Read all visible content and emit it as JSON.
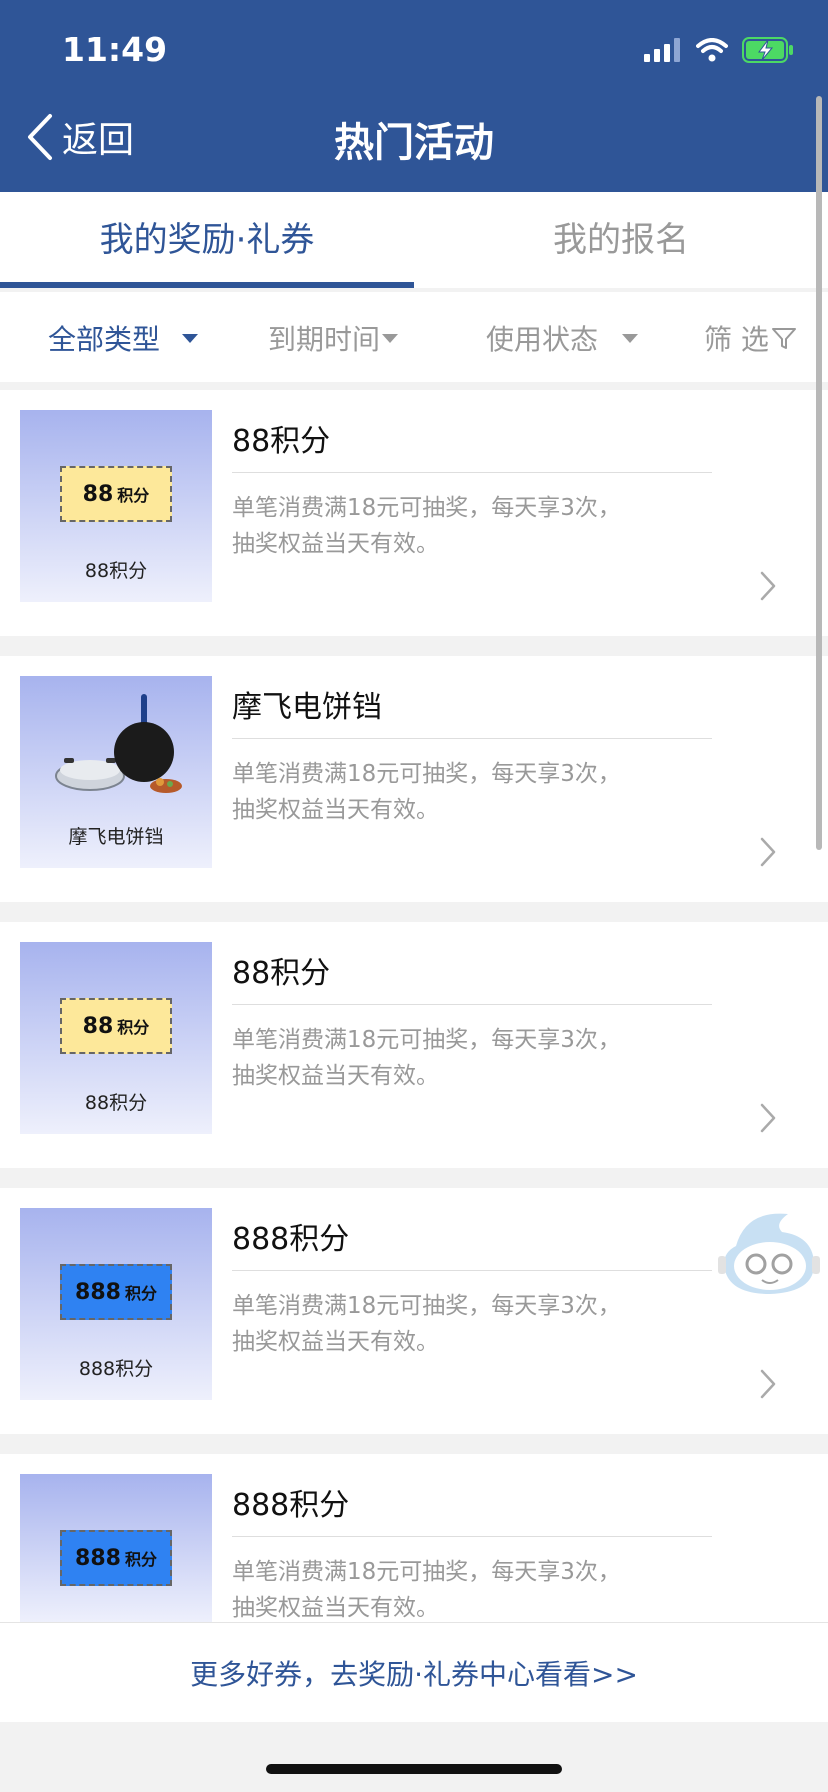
{
  "status_bar": {
    "time": "11:49"
  },
  "header": {
    "back_label": "返回",
    "title": "热门活动"
  },
  "tabs": [
    {
      "label": "我的奖励·礼券",
      "active": true
    },
    {
      "label": "我的报名",
      "active": false
    }
  ],
  "filters": [
    {
      "label": "全部类型",
      "active": true
    },
    {
      "label": "到期时间",
      "active": false
    },
    {
      "label": "使用状态",
      "active": false
    },
    {
      "label": "筛 选",
      "active": false
    }
  ],
  "cards": [
    {
      "title": "88积分",
      "desc_line1": "单笔消费满18元可抽奖，每天享3次，",
      "desc_line2": "抽奖权益当天有效。",
      "thumb_num": "88",
      "thumb_unit": "积分",
      "thumb_caption": "88积分",
      "thumb_style": "yellow"
    },
    {
      "title": "摩飞电饼铛",
      "desc_line1": "单笔消费满18元可抽奖，每天享3次，",
      "desc_line2": "抽奖权益当天有效。",
      "thumb_caption": "摩飞电饼铛",
      "thumb_style": "product"
    },
    {
      "title": "88积分",
      "desc_line1": "单笔消费满18元可抽奖，每天享3次，",
      "desc_line2": "抽奖权益当天有效。",
      "thumb_num": "88",
      "thumb_unit": "积分",
      "thumb_caption": "88积分",
      "thumb_style": "yellow"
    },
    {
      "title": "888积分",
      "desc_line1": "单笔消费满18元可抽奖，每天享3次，",
      "desc_line2": "抽奖权益当天有效。",
      "thumb_num": "888",
      "thumb_unit": "积分",
      "thumb_caption": "888积分",
      "thumb_style": "blue"
    },
    {
      "title": "888积分",
      "desc_line1": "单笔消费满18元可抽奖，每天享3次，",
      "desc_line2": "抽奖权益当天有效。",
      "thumb_num": "888",
      "thumb_unit": "积分",
      "thumb_caption": "",
      "thumb_style": "blue"
    }
  ],
  "footer": {
    "link": "更多好券，去奖励·礼券中心看看>>"
  },
  "colors": {
    "primary": "#2f5597",
    "ticket_yellow": "#fde89a",
    "ticket_blue": "#2f82f2",
    "battery_green": "#4cd964"
  },
  "icons": [
    "chevron-left-icon",
    "signal-icon",
    "wifi-icon",
    "battery-charging-icon",
    "caret-down-icon",
    "filter-funnel-icon",
    "chevron-right-icon",
    "mascot-icon"
  ]
}
